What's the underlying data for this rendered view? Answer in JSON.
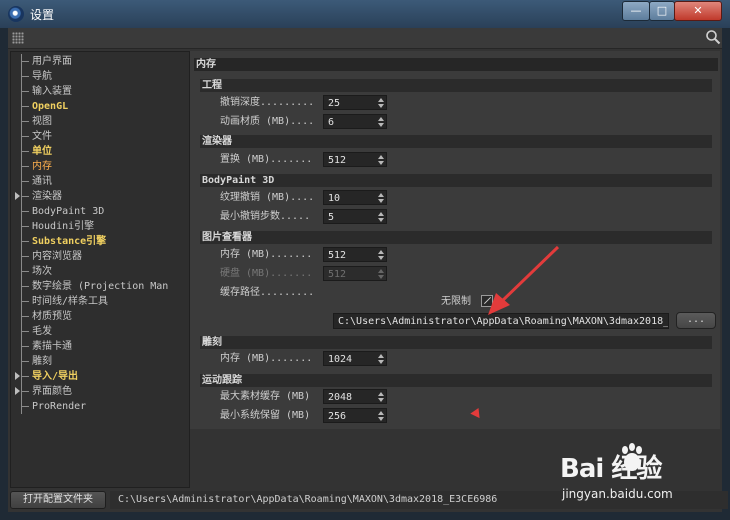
{
  "window": {
    "title": "设置",
    "buttons": {
      "minimize": "—",
      "maximize": "□",
      "close": "✕"
    }
  },
  "sidebar": {
    "items": [
      {
        "label": "用户界面"
      },
      {
        "label": "导航"
      },
      {
        "label": "输入装置"
      },
      {
        "label": "OpenGL"
      },
      {
        "label": "视图"
      },
      {
        "label": "文件"
      },
      {
        "label": "单位"
      },
      {
        "label": "内存"
      },
      {
        "label": "通讯"
      },
      {
        "label": "渲染器"
      },
      {
        "label": "BodyPaint 3D"
      },
      {
        "label": "Houdini引擎"
      },
      {
        "label": "Substance引擎"
      },
      {
        "label": "内容浏览器"
      },
      {
        "label": "场次"
      },
      {
        "label": "数字绘景 (Projection Man"
      },
      {
        "label": "时间线/样条工具"
      },
      {
        "label": "材质预览"
      },
      {
        "label": "毛发"
      },
      {
        "label": "素描卡通"
      },
      {
        "label": "雕刻"
      },
      {
        "label": "导入/导出"
      },
      {
        "label": "界面颜色"
      },
      {
        "label": "ProRender"
      }
    ]
  },
  "main": {
    "title": "内存",
    "groups": {
      "project": {
        "header": "工程",
        "undo_depth_label": "撤销深度.........",
        "undo_depth_value": "25",
        "anim_material_label": "动画材质 (MB)....",
        "anim_material_value": "6"
      },
      "renderer": {
        "header": "渲染器",
        "displace_label": "置换 (MB).......",
        "displace_value": "512"
      },
      "bodypaint": {
        "header": "BodyPaint 3D",
        "texture_undo_label": "纹理撤销 (MB)....",
        "texture_undo_value": "10",
        "min_undo_label": "最小撤销步数.....",
        "min_undo_value": "5"
      },
      "picture_viewer": {
        "header": "图片查看器",
        "memory_label": "内存 (MB).......",
        "memory_value": "512",
        "disk_label": "硬盘 (MB).......",
        "disk_value": "512",
        "unlimited_label": "无限制",
        "cache_path_label": "缓存路径.........",
        "cache_path_value": "C:\\Users\\Administrator\\AppData\\Roaming\\MAXON\\3dmax2018_",
        "browse_label": "..."
      },
      "sculpt": {
        "header": "雕刻",
        "memory_label": "内存 (MB).......",
        "memory_value": "1024"
      },
      "motion_tracking": {
        "header": "运动跟踪",
        "max_footage_label": "最大素材缓存 (MB)",
        "max_footage_value": "2048",
        "min_reserve_label": "最小系统保留 (MB)",
        "min_reserve_value": "256"
      }
    }
  },
  "bottom": {
    "open_config_label": "打开配置文件夹",
    "config_path": "C:\\Users\\Administrator\\AppData\\Roaming\\MAXON\\3dmax2018_E3CE6986"
  },
  "watermark": {
    "logo": "Bai 经验",
    "site": "jingyan.baidu.com"
  },
  "colors": {
    "accent_selected": "#ffb14e",
    "highlight_items": "#f0d060",
    "annotation_arrow": "#e23b3b"
  }
}
